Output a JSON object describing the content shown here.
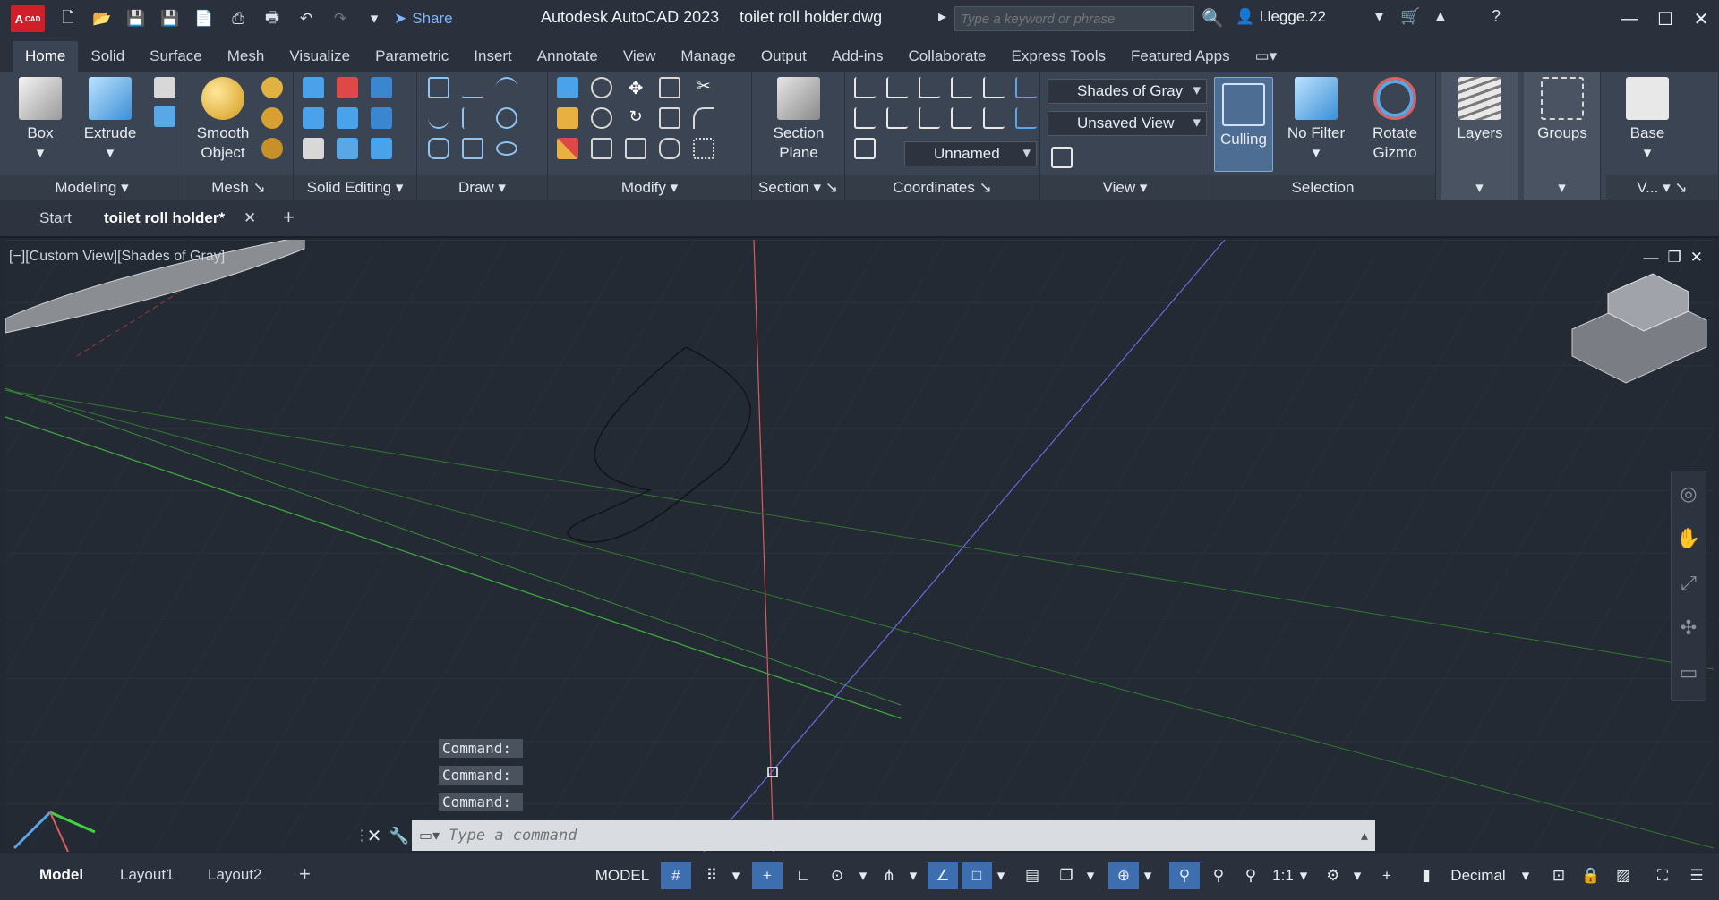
{
  "titlebar": {
    "logo_text": "A",
    "logo_sub": "CAD",
    "share_label": "Share",
    "app_title": "Autodesk AutoCAD 2023",
    "file_name": "toilet roll holder.dwg",
    "search_placeholder": "Type a keyword or phrase",
    "user_name": "l.legge.22"
  },
  "ribbon_tabs": [
    "Home",
    "Solid",
    "Surface",
    "Mesh",
    "Visualize",
    "Parametric",
    "Insert",
    "Annotate",
    "View",
    "Manage",
    "Output",
    "Add-ins",
    "Collaborate",
    "Express Tools",
    "Featured Apps"
  ],
  "ribbon": {
    "panels": {
      "modeling": "Modeling",
      "mesh": "Mesh",
      "solid_editing": "Solid Editing",
      "draw": "Draw",
      "modify": "Modify",
      "section": "Section",
      "coordinates": "Coordinates",
      "view": "View",
      "selection": "Selection"
    },
    "buttons": {
      "box": "Box",
      "extrude": "Extrude",
      "smooth_object_1": "Smooth",
      "smooth_object_2": "Object",
      "section_plane_1": "Section",
      "section_plane_2": "Plane",
      "culling": "Culling",
      "no_filter": "No Filter",
      "rotate_gizmo_1": "Rotate",
      "rotate_gizmo_2": "Gizmo",
      "layers": "Layers",
      "groups": "Groups",
      "base": "Base",
      "v_panel": "V..."
    },
    "dropdowns": {
      "visual_style": "Shades of Gray",
      "named_view": "Unsaved View",
      "ucs": "Unnamed"
    }
  },
  "doc_tabs": {
    "start": "Start",
    "active": "toilet roll holder*"
  },
  "viewport": {
    "label": "[−][Custom View][Shades of Gray]",
    "command_history": [
      "Command:",
      "Command:",
      "Command:"
    ],
    "command_placeholder": "Type a command"
  },
  "statusbar": {
    "tabs": [
      "Model",
      "Layout1",
      "Layout2"
    ],
    "model_label": "MODEL",
    "scale": "1:1",
    "units": "Decimal"
  },
  "colors": {
    "accent": "#3d6fb0",
    "logo_red": "#cf1f2a",
    "x_axis": "#e05a5a",
    "y_axis": "#58c558",
    "z_axis": "#6a6ae0"
  }
}
